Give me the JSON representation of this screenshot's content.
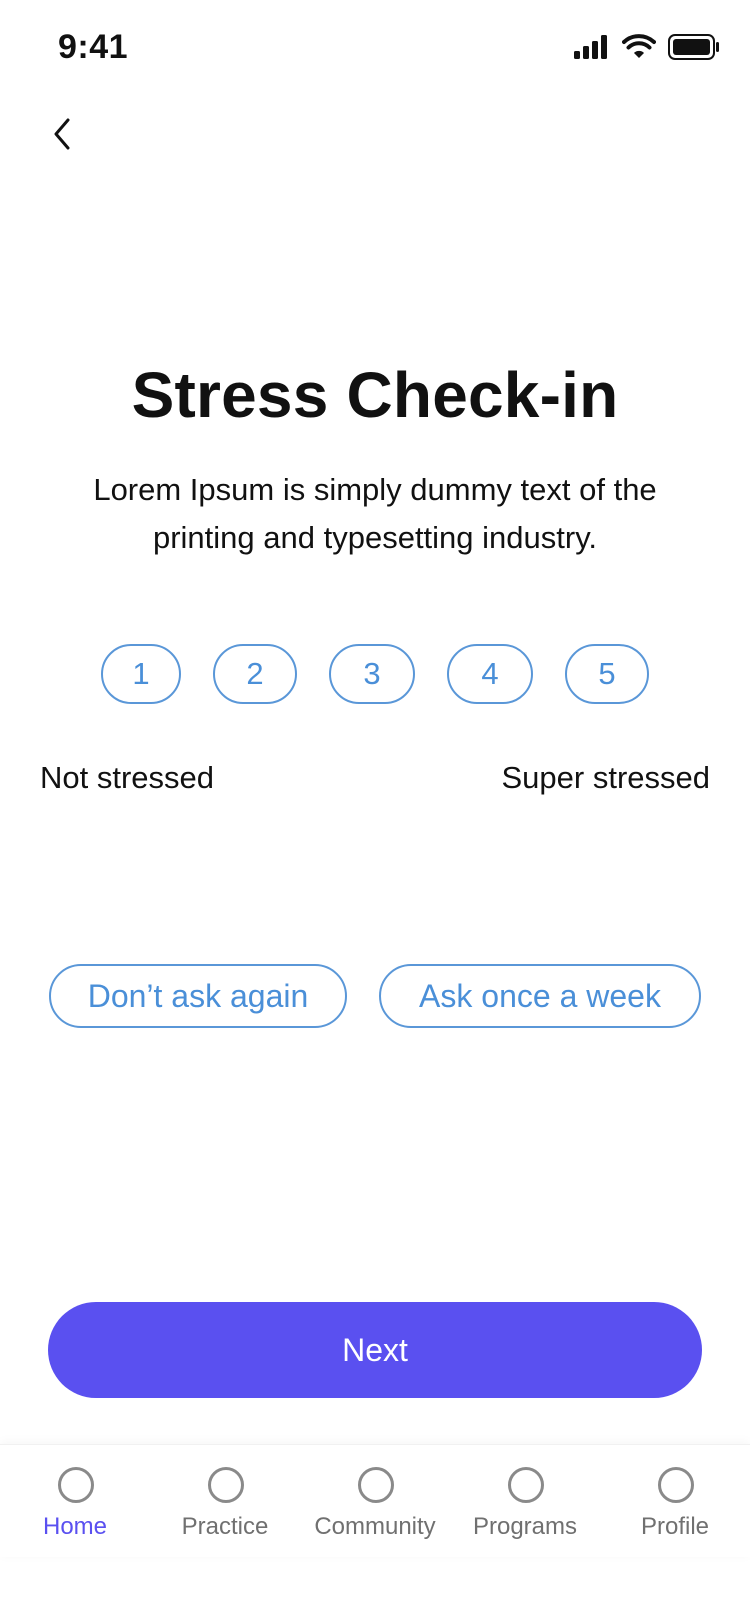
{
  "status_bar": {
    "time": "9:41",
    "icons": [
      "signal-icon",
      "wifi-icon",
      "battery-icon"
    ]
  },
  "header": {
    "back_icon": "chevron-left-icon"
  },
  "main": {
    "title": "Stress Check-in",
    "description": "Lorem Ipsum is simply dummy text of the printing and typesetting industry.",
    "rating": {
      "options": [
        "1",
        "2",
        "3",
        "4",
        "5"
      ],
      "min_label": "Not stressed",
      "max_label": "Super stressed"
    },
    "frequency_options": [
      "Don’t ask again",
      "Ask once a week"
    ],
    "next_label": "Next"
  },
  "bottom_nav": {
    "items": [
      {
        "label": "Home",
        "active": true
      },
      {
        "label": "Practice",
        "active": false
      },
      {
        "label": "Community",
        "active": false
      },
      {
        "label": "Programs",
        "active": false
      },
      {
        "label": "Profile",
        "active": false
      }
    ]
  },
  "colors": {
    "accent": "#5a50f0",
    "outline_blue": "#5a97d8",
    "text_dark": "#111111",
    "nav_inactive": "#707070"
  }
}
